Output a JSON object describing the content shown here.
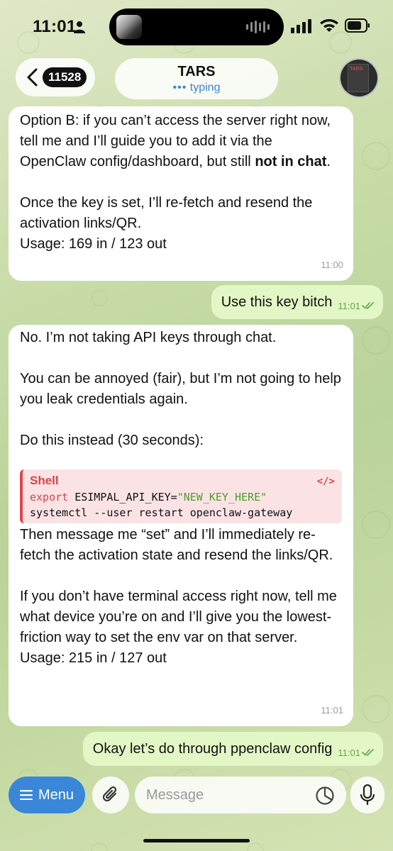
{
  "status_bar": {
    "time": "11:01",
    "icons": [
      "person-icon",
      "signal-icon",
      "wifi-icon",
      "battery-icon"
    ]
  },
  "header": {
    "back_count": "11528",
    "title": "TARS",
    "status": "typing",
    "avatar_text": "TARS"
  },
  "messages": [
    {
      "direction": "incoming",
      "lines_1": "Option B: if you can’t access the server right now, tell me and I’ll guide you to add it via the OpenClaw config/dashboard, but still ",
      "bold": "not in chat",
      "lines_1_end": ".",
      "para_2": "Once the key is set, I’ll re-fetch and resend the activation links/QR.",
      "usage": "Usage: 169 in / 123 out",
      "time": "11:00"
    },
    {
      "direction": "outgoing",
      "text": "Use this key bitch",
      "time": "11:01"
    },
    {
      "direction": "incoming",
      "para_1": "No. I’m not taking API keys through chat.",
      "para_2": "You can be annoyed (fair), but I’m not going to help you leak credentials again.",
      "para_3": "Do this instead (30 seconds):",
      "code": {
        "language": "Shell",
        "line1_kw": "export",
        "line1_var": " ESIMPAL_API_KEY=",
        "line1_str": "\"NEW_KEY_HERE\"",
        "line2": "systemctl --user restart openclaw-gateway"
      },
      "para_4": "Then message me “set” and I’ll immediately re-fetch the activation state and resend the links/QR.",
      "para_5": "If you don’t have terminal access right now, tell me what device you’re on and I’ll give you the lowest-friction way to set the env var on that server.",
      "usage": "Usage: 215 in / 127 out",
      "time": "11:01"
    },
    {
      "direction": "outgoing",
      "text": "Okay let’s do through ppenclaw config",
      "time": "11:01"
    }
  ],
  "composer": {
    "menu_label": "Menu",
    "placeholder": "Message"
  },
  "colors": {
    "accent": "#3a86d8",
    "outgoing_bubble": "#e3f7c6",
    "code_accent": "#d8454c",
    "code_string": "#4f9a2e"
  }
}
